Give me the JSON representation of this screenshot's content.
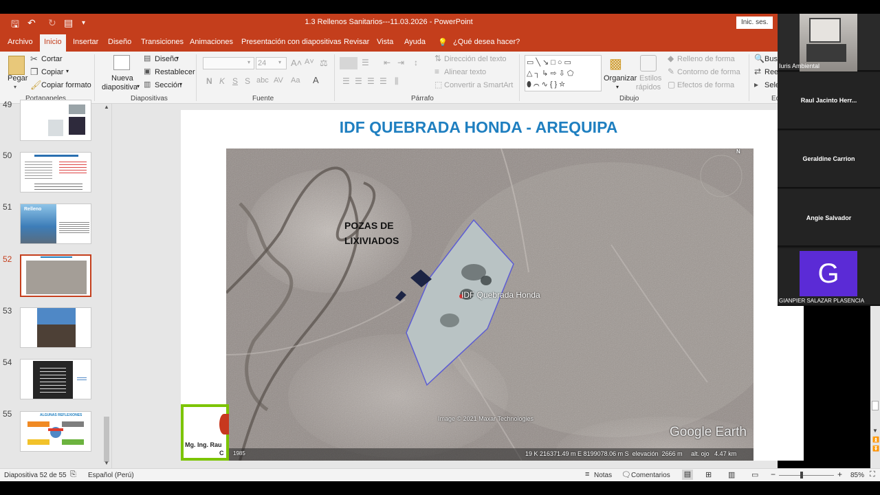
{
  "window": {
    "title": "1.3 Rellenos Sanitarios---11.03.2026  -  PowerPoint",
    "signin_label": "Inic. ses."
  },
  "tabs": [
    {
      "label": "Archivo"
    },
    {
      "label": "Inicio"
    },
    {
      "label": "Insertar"
    },
    {
      "label": "Diseño"
    },
    {
      "label": "Transiciones"
    },
    {
      "label": "Animaciones"
    },
    {
      "label": "Presentación con diapositivas"
    },
    {
      "label": "Revisar"
    },
    {
      "label": "Vista"
    },
    {
      "label": "Ayuda"
    },
    {
      "label": "¿Qué desea hacer?"
    }
  ],
  "ribbon": {
    "portapapeles": {
      "paste": "Pegar",
      "cut": "Cortar",
      "copy": "Copiar",
      "format_painter": "Copiar formato",
      "group": "Portapapeles"
    },
    "diapositivas": {
      "new_slide_1": "Nueva",
      "new_slide_2": "diapositiva",
      "layout": "Diseño",
      "reset": "Restablecer",
      "section": "Sección",
      "group": "Diapositivas"
    },
    "fuente": {
      "size": "24",
      "group": "Fuente"
    },
    "parrafo": {
      "text_direction": "Dirección del texto",
      "align_text": "Alinear texto",
      "smartart": "Convertir a SmartArt",
      "group": "Párrafo"
    },
    "dibujo": {
      "arrange": "Organizar",
      "styles_1": "Estilos",
      "styles_2": "rápidos",
      "fill": "Relleno de forma",
      "outline": "Contorno de forma",
      "effects": "Efectos de forma",
      "group": "Dibujo"
    },
    "edicion": {
      "find": "Busc",
      "replace": "Reem",
      "select": "Sele",
      "group": "Ed"
    }
  },
  "thumbnails": [
    {
      "num": "49"
    },
    {
      "num": "50"
    },
    {
      "num": "51"
    },
    {
      "num": "52"
    },
    {
      "num": "53"
    },
    {
      "num": "54"
    },
    {
      "num": "55"
    }
  ],
  "thumb_texts": {
    "t51_label": "Relleno",
    "t55_title": "ALGUNAS REFLEXIONES"
  },
  "slide": {
    "title": "IDF QUEBRADA HONDA - AREQUIPA",
    "pozas_line1": "POZAS DE",
    "pozas_line2": "LIXIVIADOS",
    "place_label": "IDF Quebrada Honda",
    "image_credit": "Image © 2021 Maxar Technologies",
    "google_earth": "Google Earth",
    "year": "1985",
    "coords": "19 K 216371.49 m E 8199078.06 m S  elevación  2666 m     alt. ojo   4.47 km",
    "north": "N",
    "author_1": "Mg. Ing. Rau",
    "author_2": "C"
  },
  "status": {
    "slide_info": "Diapositiva 52 de 55",
    "language": "Español (Perú)",
    "notes": "Notas",
    "comments": "Comentarios",
    "zoom": "85%"
  },
  "participants": [
    {
      "name": "Iuris Ambiental"
    },
    {
      "name": "Raul  Jacinto  Herr..."
    },
    {
      "name": "Geraldine Carrion"
    },
    {
      "name": "Angie Salvador"
    },
    {
      "name": "GIANPIER SALAZAR PLASENCIA",
      "initial": "G"
    }
  ],
  "colors": {
    "accent": "#c43e1c",
    "slide_title": "#1f7fc0",
    "avatar": "#5b2bd6"
  }
}
